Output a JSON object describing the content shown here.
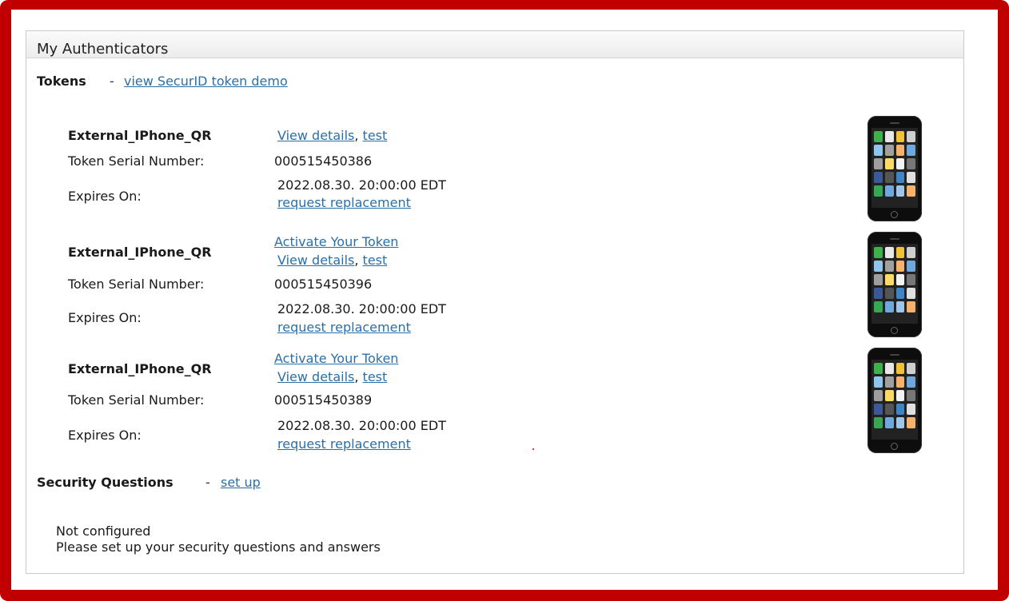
{
  "panel": {
    "title": "My Authenticators"
  },
  "tokens_section": {
    "title": "Tokens",
    "separator": "-",
    "demo_link": "view SecurID token demo",
    "tokens": [
      {
        "name": "External_IPhone_QR",
        "view_details": "View details",
        "comma": ",",
        "test": "test",
        "serial_label": "Token Serial Number:",
        "serial": "000515450386",
        "expires_label": "Expires On:",
        "expires": "2022.08.30. 20:00:00 EDT",
        "replace": "request replacement"
      },
      {
        "name": "External_IPhone_QR",
        "activate": "Activate Your Token",
        "view_details": "View details",
        "comma": ",",
        "test": "test",
        "serial_label": "Token Serial Number:",
        "serial": "000515450396",
        "expires_label": "Expires On:",
        "expires": "2022.08.30. 20:00:00 EDT",
        "replace": "request replacement"
      },
      {
        "name": "External_IPhone_QR",
        "activate": "Activate Your Token",
        "view_details": "View details",
        "comma": ",",
        "test": "test",
        "serial_label": "Token Serial Number:",
        "serial": "000515450389",
        "expires_label": "Expires On:",
        "expires": "2022.08.30. 20:00:00 EDT",
        "replace": "request replacement"
      }
    ],
    "device_icon": "smartphone-icon"
  },
  "security_section": {
    "title": "Security Questions",
    "separator": "-",
    "setup_link": "set up",
    "status": "Not configured",
    "message": "Please set up your security questions and answers"
  },
  "colors": {
    "frame": "#c00000",
    "link": "#2a70a8"
  }
}
